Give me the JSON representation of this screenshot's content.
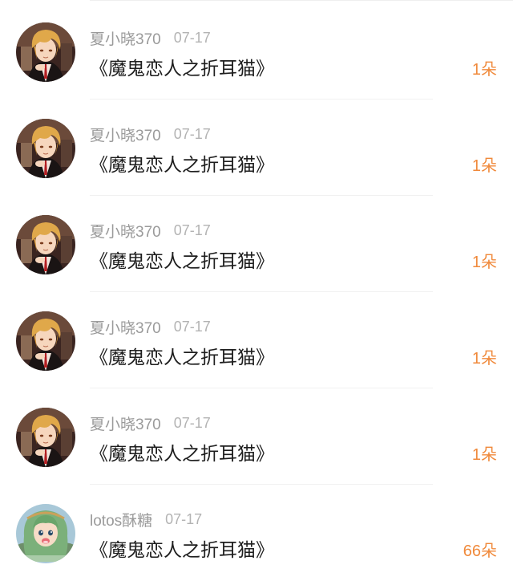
{
  "records": [
    {
      "user": "夏小晓370",
      "date": "07-17",
      "gift": "《魔鬼恋人之折耳猫》",
      "count": "1朵",
      "avatar_icon": "anime-boy-avatar"
    },
    {
      "user": "夏小晓370",
      "date": "07-17",
      "gift": "《魔鬼恋人之折耳猫》",
      "count": "1朵",
      "avatar_icon": "anime-boy-avatar"
    },
    {
      "user": "夏小晓370",
      "date": "07-17",
      "gift": "《魔鬼恋人之折耳猫》",
      "count": "1朵",
      "avatar_icon": "anime-boy-avatar"
    },
    {
      "user": "夏小晓370",
      "date": "07-17",
      "gift": "《魔鬼恋人之折耳猫》",
      "count": "1朵",
      "avatar_icon": "anime-boy-avatar"
    },
    {
      "user": "夏小晓370",
      "date": "07-17",
      "gift": "《魔鬼恋人之折耳猫》",
      "count": "1朵",
      "avatar_icon": "anime-boy-avatar"
    },
    {
      "user": "lotos酥糖",
      "date": "07-17",
      "gift": "《魔鬼恋人之折耳猫》",
      "count": "66朵",
      "avatar_icon": "green-hair-girl-avatar"
    }
  ],
  "colors": {
    "username": "#9a9a9a",
    "date": "#b3b3b3",
    "gift_title": "#1e1e1e",
    "count_accent": "#f08a3c",
    "divider": "#f1f1f1"
  }
}
